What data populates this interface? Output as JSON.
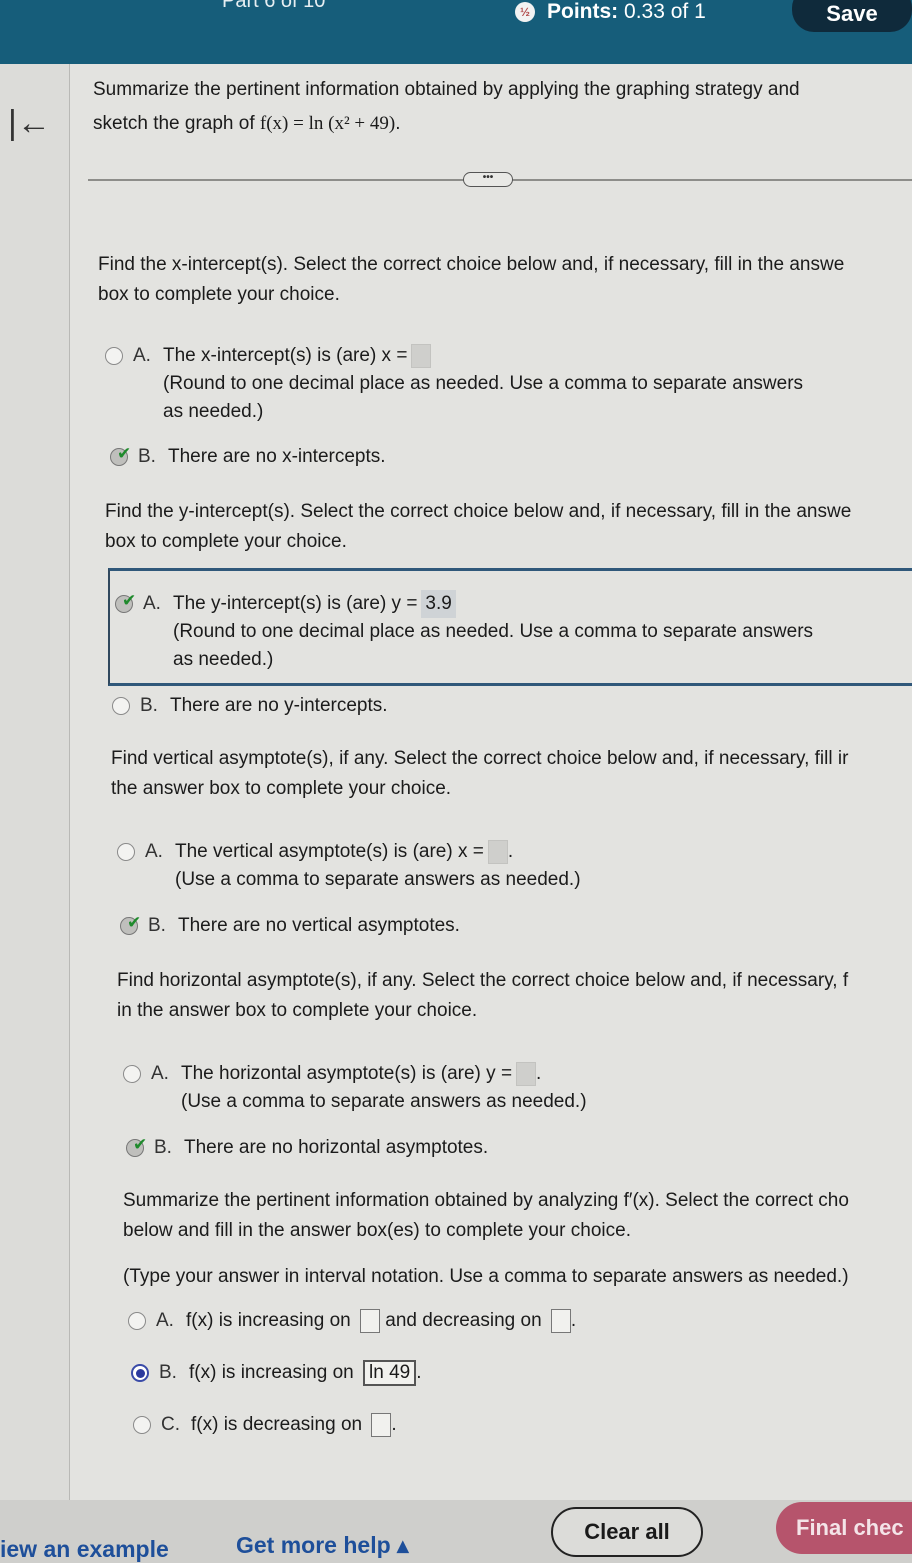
{
  "header": {
    "part_label": "Part 6 of 10",
    "points_label": "Points:",
    "points_value": "0.33 of 1",
    "save_label": "Save"
  },
  "question": {
    "title_line1": "Summarize the pertinent information obtained by applying the graphing strategy and",
    "title_line2_prefix": "sketch the graph of ",
    "function": "f(x) = ln (x² + 49)",
    "title_line2_suffix": ".",
    "more_label": "•••"
  },
  "sections": {
    "x_intercept": {
      "prompt_line1": "Find the x-intercept(s). Select the correct choice below and, if necessary, fill in the answe",
      "prompt_line2": "box to complete your choice.",
      "option_a_letter": "A.",
      "option_a_text": "The x-intercept(s) is (are) x =",
      "option_a_note1": "(Round to one decimal place as needed. Use a comma to separate answers",
      "option_a_note2": "as needed.)",
      "option_a_value": "",
      "option_b_letter": "B.",
      "option_b_text": "There are no x-intercepts.",
      "selected": "B",
      "status": "correct"
    },
    "y_intercept": {
      "prompt_line1": "Find the y-intercept(s). Select the correct choice below and, if necessary, fill in the answe",
      "prompt_line2": "box to complete your choice.",
      "option_a_letter": "A.",
      "option_a_text": "The y-intercept(s) is (are) y =",
      "option_a_value": "3.9",
      "option_a_note1": "(Round to one decimal place as needed. Use a comma to separate answers",
      "option_a_note2": "as needed.)",
      "option_b_letter": "B.",
      "option_b_text": "There are no y-intercepts.",
      "selected": "A",
      "status": "correct"
    },
    "vertical_asymptote": {
      "prompt_line1": "Find vertical asymptote(s), if any. Select the correct choice below and, if necessary, fill ir",
      "prompt_line2": "the answer box to complete your choice.",
      "option_a_letter": "A.",
      "option_a_text": "The vertical asymptote(s) is (are) x =",
      "option_a_value": "",
      "option_a_note": "(Use a comma to separate answers as needed.)",
      "option_b_letter": "B.",
      "option_b_text": "There are no vertical asymptotes.",
      "selected": "B",
      "status": "correct"
    },
    "horizontal_asymptote": {
      "prompt_line1": "Find horizontal asymptote(s), if any. Select the correct choice below and, if necessary, f",
      "prompt_line2": "in the answer box to complete your choice.",
      "option_a_letter": "A.",
      "option_a_text": "The horizontal asymptote(s) is (are) y =",
      "option_a_value": "",
      "option_a_note": "(Use a comma to separate answers as needed.)",
      "option_b_letter": "B.",
      "option_b_text": "There are no horizontal asymptotes.",
      "selected": "B",
      "status": "correct"
    },
    "derivative": {
      "prompt_line1": "Summarize the pertinent information obtained by analyzing f′(x). Select the correct cho",
      "prompt_line2": "below and fill in the answer box(es) to complete your choice.",
      "instruction": "(Type your answer in interval notation. Use a comma to separate answers as needed.)",
      "option_a_letter": "A.",
      "option_a_text1": "f(x) is increasing on",
      "option_a_text2": "and decreasing on",
      "option_a_value1": "",
      "option_a_value2": "",
      "option_b_letter": "B.",
      "option_b_text": "f(x) is increasing on",
      "option_b_value": "ln 49",
      "option_c_letter": "C.",
      "option_c_text": "f(x) is decreasing on",
      "option_c_value": "",
      "selected": "B"
    }
  },
  "footer": {
    "view_example": "iew an example",
    "get_more_help": "Get more help ▴",
    "clear_all": "Clear all",
    "final_check": "Final chec"
  },
  "colors": {
    "header_bg": "#165d7a",
    "link": "#1e4f9a",
    "correct_check": "#1f8a2c",
    "final_check_bg": "#b6546c"
  }
}
